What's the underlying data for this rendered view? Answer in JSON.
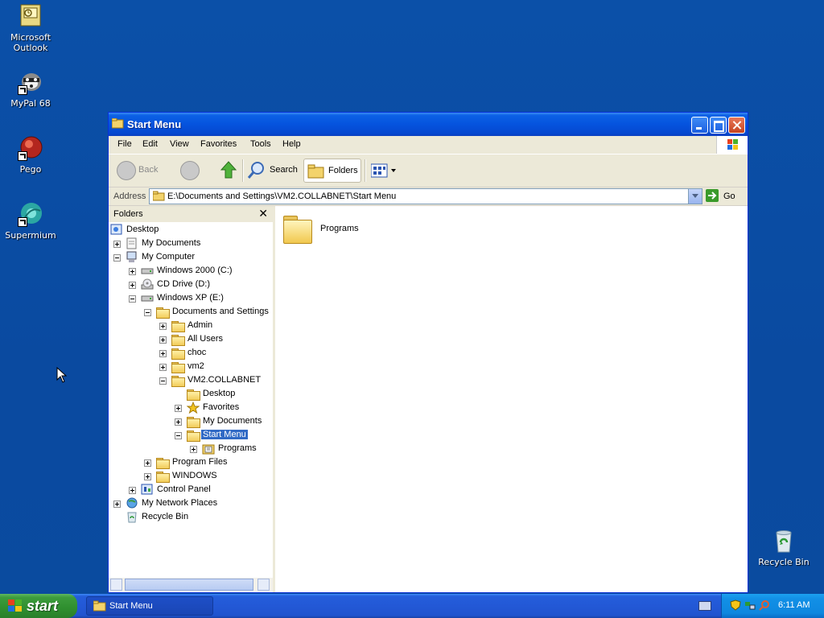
{
  "desktop": {
    "icons": [
      {
        "label": "Microsoft Outlook"
      },
      {
        "label": "MyPal 68"
      },
      {
        "label": "Pego"
      },
      {
        "label": "Supermium"
      },
      {
        "label": "Recycle Bin"
      }
    ]
  },
  "window": {
    "title": "Start Menu",
    "menu": [
      "File",
      "Edit",
      "View",
      "Favorites",
      "Tools",
      "Help"
    ],
    "toolbar": {
      "back_label": "Back",
      "search_label": "Search",
      "folders_label": "Folders"
    },
    "address": {
      "label": "Address",
      "value": "E:\\Documents and Settings\\VM2.COLLABNET\\Start Menu",
      "go_label": "Go"
    },
    "folders_pane": {
      "title": "Folders",
      "tree": [
        {
          "label": "Desktop"
        },
        {
          "label": "My Documents"
        },
        {
          "label": "My Computer"
        },
        {
          "label": "Windows 2000 (C:)"
        },
        {
          "label": "CD Drive (D:)"
        },
        {
          "label": "Windows XP (E:)"
        },
        {
          "label": "Documents and Settings"
        },
        {
          "label": "Admin"
        },
        {
          "label": "All Users"
        },
        {
          "label": "choc"
        },
        {
          "label": "vm2"
        },
        {
          "label": "VM2.COLLABNET"
        },
        {
          "label": "Desktop"
        },
        {
          "label": "Favorites"
        },
        {
          "label": "My Documents"
        },
        {
          "label": "Start Menu"
        },
        {
          "label": "Programs"
        },
        {
          "label": "Program Files"
        },
        {
          "label": "WINDOWS"
        },
        {
          "label": "Control Panel"
        },
        {
          "label": "My Network Places"
        },
        {
          "label": "Recycle Bin"
        }
      ]
    },
    "content": {
      "items": [
        {
          "label": "Programs"
        }
      ]
    }
  },
  "taskbar": {
    "start_label": "start",
    "task_label": "Start Menu",
    "clock": "6:11 AM"
  },
  "colors": {
    "desktop": "#0a4a9e",
    "titlebar": "#0553de",
    "selection": "#316ac5",
    "start_button": "#2f8f2f"
  }
}
